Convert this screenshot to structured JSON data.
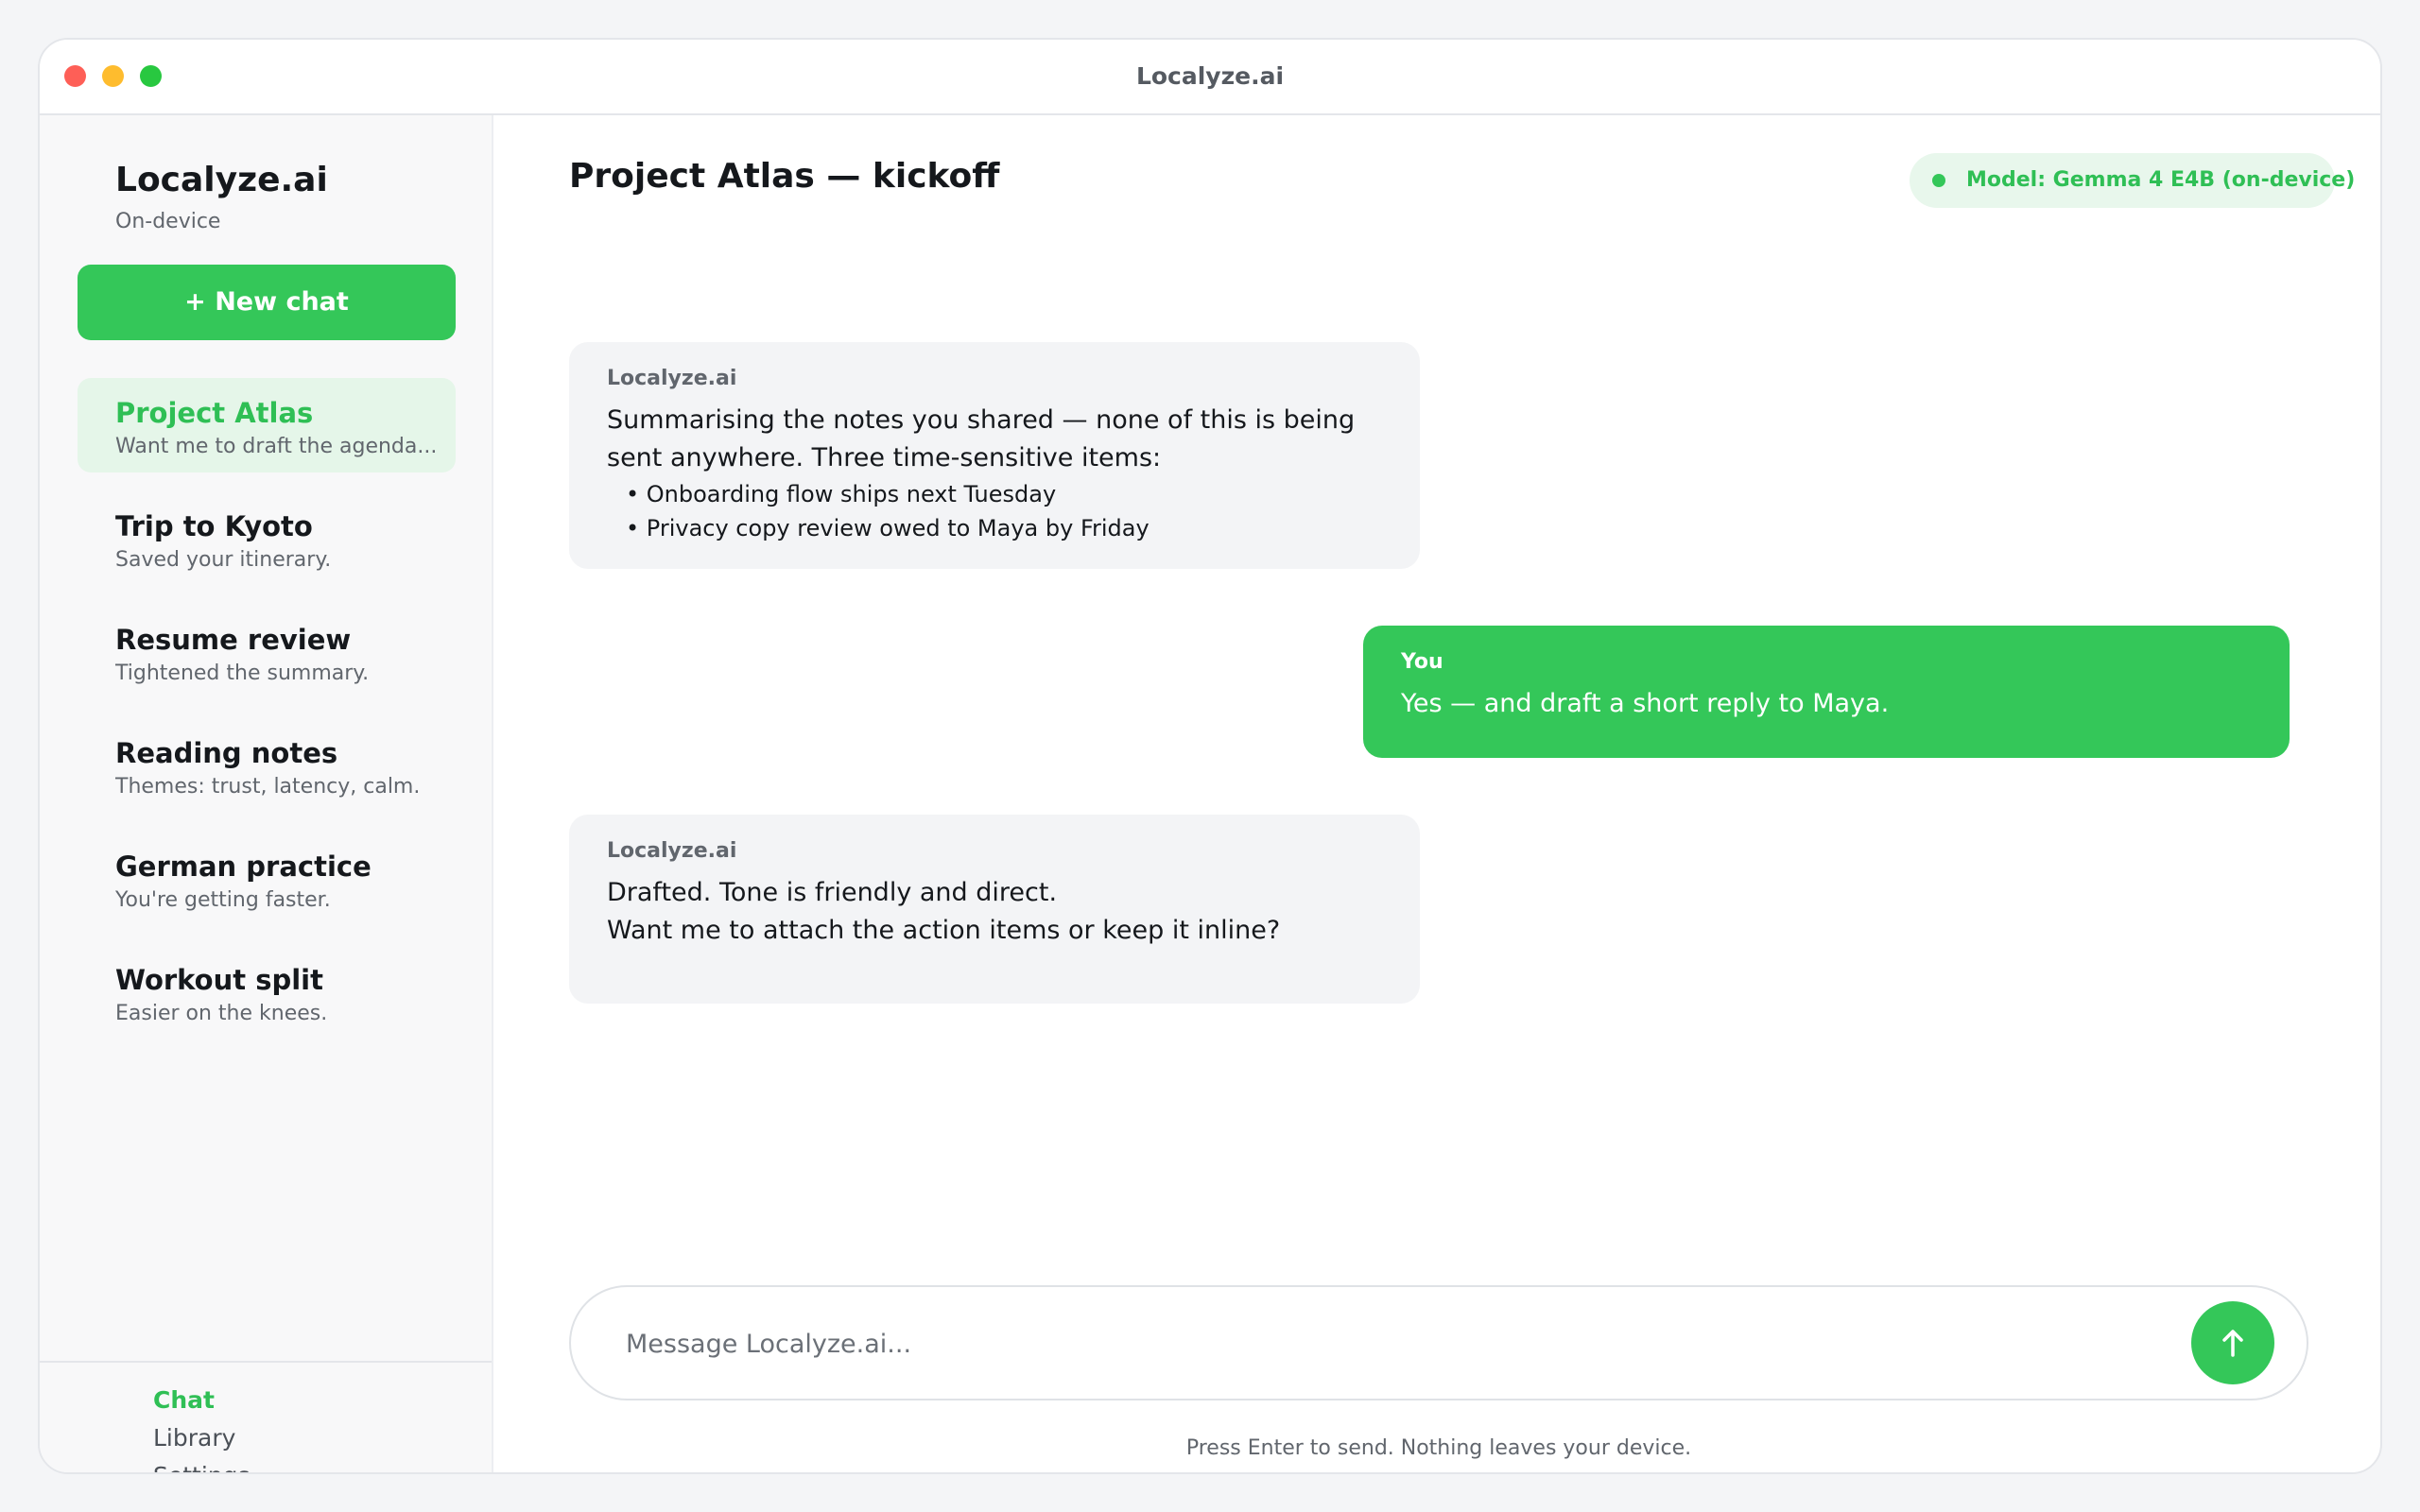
{
  "window": {
    "title": "Localyze.ai"
  },
  "sidebar": {
    "brand": "Localyze.ai",
    "brand_sub": "On-device",
    "new_chat_label": "+ New chat",
    "conversations": [
      {
        "title": "Project Atlas",
        "preview": "Want me to draft the agenda...",
        "active": true
      },
      {
        "title": "Trip to Kyoto",
        "preview": "Saved your itinerary."
      },
      {
        "title": "Resume review",
        "preview": "Tightened the summary."
      },
      {
        "title": "Reading notes",
        "preview": "Themes: trust, latency, calm."
      },
      {
        "title": "German practice",
        "preview": "You're getting faster."
      },
      {
        "title": "Workout split",
        "preview": "Easier on the knees."
      }
    ],
    "nav": [
      {
        "label": "Chat",
        "active": true
      },
      {
        "label": "Library"
      },
      {
        "label": "Settings"
      }
    ]
  },
  "main": {
    "title": "Project Atlas — kickoff",
    "model_label": "Model: Gemma 4 E4B (on-device)",
    "messages": [
      {
        "author": "Localyze.ai",
        "text": "Summarising the notes you shared — none of this is being\nsent anywhere. Three time-sensitive items:",
        "bullets": [
          "• Onboarding flow ships next Tuesday",
          "• Privacy copy review owed to Maya by Friday"
        ]
      },
      {
        "author": "You",
        "text": "Yes — and draft a short reply to Maya."
      },
      {
        "author": "Localyze.ai",
        "text": "Drafted. Tone is friendly and direct.\nWant me to attach the action items or keep it inline?"
      }
    ],
    "composer": {
      "placeholder": "Message Localyze.ai...",
      "value": "",
      "send_icon": "arrow-up-icon"
    },
    "hint": "Press Enter to send. Nothing leaves your device."
  },
  "colors": {
    "accent": "#34c759",
    "accent_soft": "#e5f6e9",
    "bubble_ai": "#f3f4f6"
  }
}
